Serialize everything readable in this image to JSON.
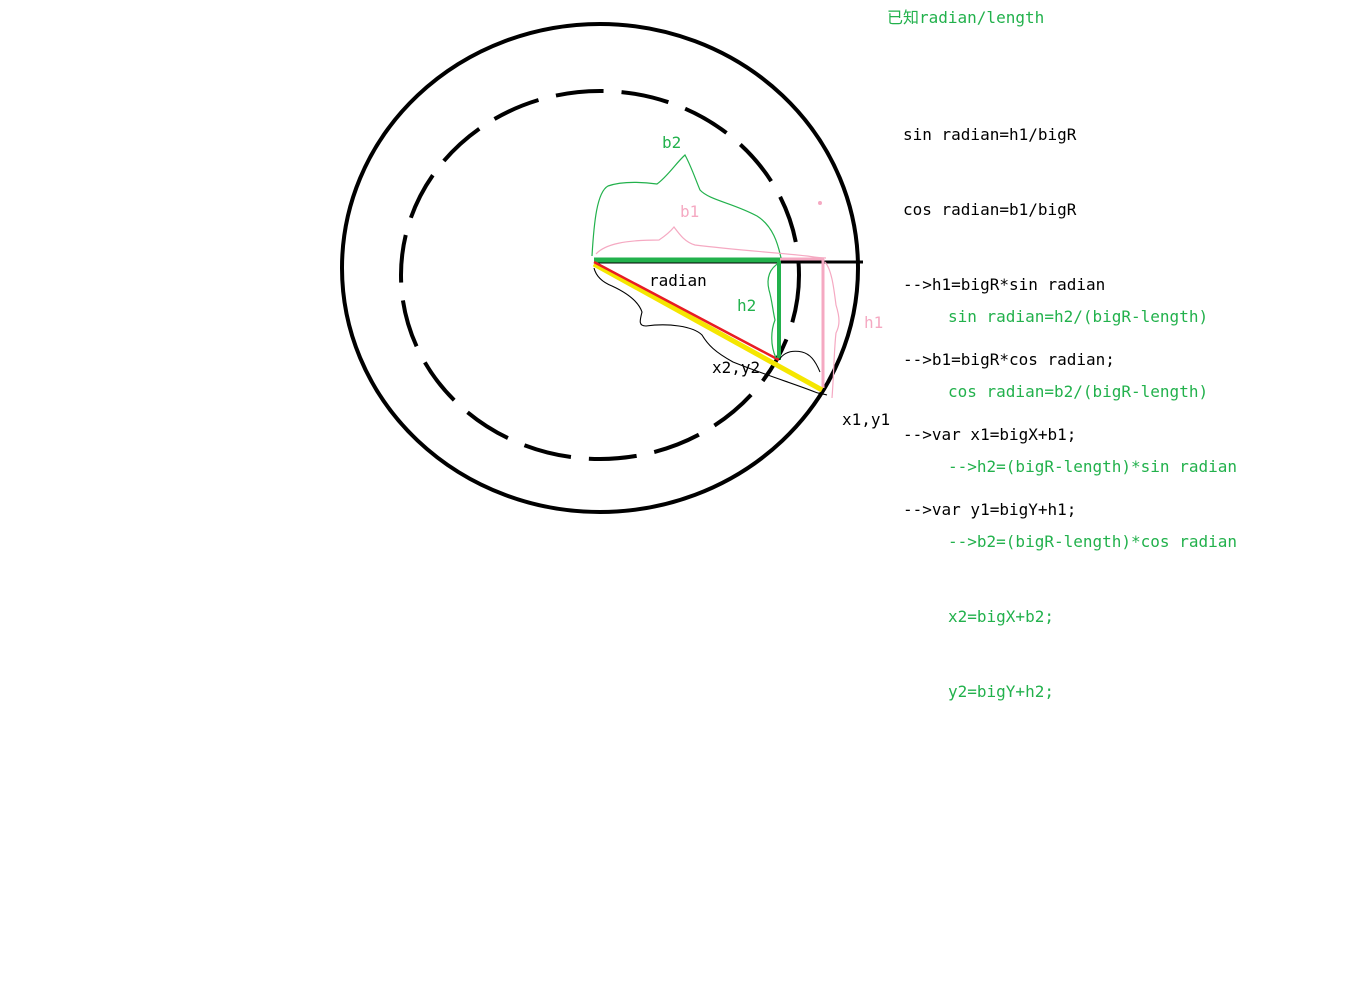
{
  "colors": {
    "black": "#000000",
    "green": "#22b14c",
    "pink": "#f5a9c2",
    "red": "#e81c24",
    "yellow": "#f5e600"
  },
  "title": "已知radian/length",
  "labels": {
    "b2": "b2",
    "b1": "b1",
    "radian": "radian",
    "h2": "h2",
    "h1": "h1",
    "x2y2": "x2,y2",
    "x1y1": "x1,y1"
  },
  "formulas_outer": [
    "sin radian=h1/bigR",
    "cos radian=b1/bigR",
    "-->h1=bigR*sin radian",
    "-->b1=bigR*cos radian;",
    "-->var x1=bigX+b1;",
    "-->var y1=bigY+h1;"
  ],
  "formulas_inner": [
    "sin radian=h2/(bigR-length)",
    "cos radian=b2/(bigR-length)",
    "-->h2=(bigR-length)*sin radian",
    "-->b2=(bigR-length)*cos radian",
    "x2=bigX+b2;",
    "y2=bigY+h2;"
  ]
}
